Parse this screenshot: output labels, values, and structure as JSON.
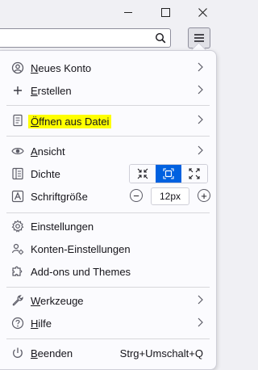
{
  "window": {
    "minimize_icon": "minimize-icon",
    "maximize_icon": "maximize-icon",
    "close_icon": "close-icon"
  },
  "toolbar": {
    "search_placeholder": "",
    "menu_icon": "hamburger-menu-icon"
  },
  "menu": {
    "items": [
      {
        "label": "Neues Konto",
        "access_key": "N",
        "icon": "new-account-icon",
        "submenu": true
      },
      {
        "label": "Erstellen",
        "access_key": "E",
        "icon": "plus-icon",
        "submenu": true
      },
      {
        "label": "Öffnen aus Datei",
        "access_key": "Ö",
        "icon": "open-file-icon",
        "submenu": true,
        "highlighted": true
      },
      {
        "label": "Ansicht",
        "access_key": "A",
        "icon": "eye-icon",
        "submenu": true
      },
      {
        "label": "Dichte",
        "icon": "density-icon"
      },
      {
        "label": "Schriftgröße",
        "icon": "font-size-icon"
      },
      {
        "label": "Einstellungen",
        "icon": "settings-gear-icon"
      },
      {
        "label": "Konten-Einstellungen",
        "icon": "account-settings-icon"
      },
      {
        "label": "Add-ons und Themes",
        "icon": "puzzle-piece-icon"
      },
      {
        "label": "Werkzeuge",
        "access_key": "W",
        "icon": "wrench-icon",
        "submenu": true
      },
      {
        "label": "Hilfe",
        "access_key": "H",
        "icon": "help-icon",
        "submenu": true
      },
      {
        "label": "Beenden",
        "access_key": "B",
        "icon": "power-icon",
        "shortcut": "Strg+Umschalt+Q"
      }
    ],
    "density": {
      "options": [
        "compact",
        "normal",
        "touch"
      ],
      "selected": "normal"
    },
    "font_size": {
      "value": "12px",
      "decrease": "−",
      "increase": "+"
    }
  },
  "colors": {
    "highlight": "#ffff00",
    "accent": "#0061e0",
    "panel_bg": "#fbfbfe",
    "window_bg": "#f0f0f4"
  }
}
